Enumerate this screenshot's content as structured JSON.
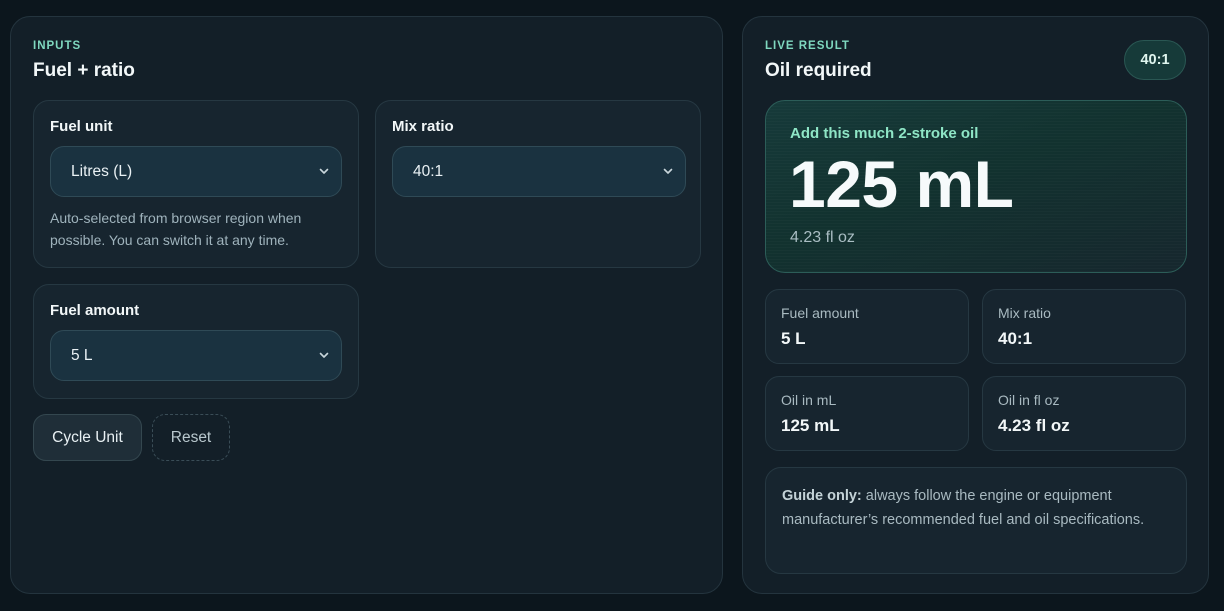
{
  "inputs": {
    "eyebrow": "INPUTS",
    "title": "Fuel + ratio",
    "fuel_unit": {
      "label": "Fuel unit",
      "value": "Litres (L)",
      "hint": "Auto-selected from browser region when possible. You can switch it at any time."
    },
    "mix_ratio": {
      "label": "Mix ratio",
      "value": "40:1"
    },
    "fuel_amount": {
      "label": "Fuel amount",
      "value": "5 L"
    },
    "buttons": {
      "cycle_unit": "Cycle Unit",
      "reset": "Reset"
    }
  },
  "result": {
    "eyebrow": "LIVE RESULT",
    "title": "Oil required",
    "badge": "40:1",
    "hero": {
      "label": "Add this much 2-stroke oil",
      "value": "125 mL",
      "sub": "4.23 fl oz"
    },
    "stats": [
      {
        "label": "Fuel amount",
        "value": "5 L"
      },
      {
        "label": "Mix ratio",
        "value": "40:1"
      },
      {
        "label": "Oil in mL",
        "value": "125 mL"
      },
      {
        "label": "Oil in fl oz",
        "value": "4.23 fl oz"
      }
    ],
    "note": {
      "strong": "Guide only:",
      "text": " always follow the engine or equipment manufacturer’s recommended fuel and oil specifications."
    }
  },
  "colors": {
    "background": "#0c161d",
    "panel": "#131f28",
    "accent": "#7fd8bf",
    "hero_label": "#8ee6c6"
  },
  "icons": {
    "select_indicator": "chevron-down-icon"
  }
}
